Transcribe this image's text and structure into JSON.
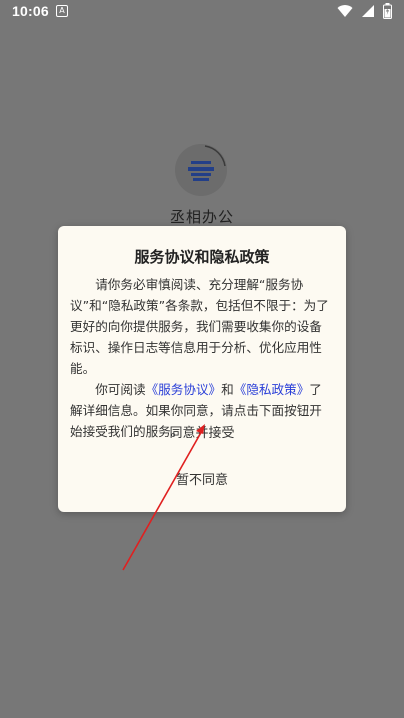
{
  "status_bar": {
    "time": "10:06",
    "notification_icon": "a-notification-icon",
    "icons": [
      "wifi-icon",
      "signal-icon",
      "battery-icon"
    ]
  },
  "splash": {
    "app_name": "丞相办公"
  },
  "dialog": {
    "title": "服务协议和隐私政策",
    "paragraph1": "请你务必审慎阅读、充分理解“服务协议”和“隐私政策”各条款，包括但不限于：为了更好的向你提供服务，我们需要收集你的设备标识、操作日志等信息用于分析、优化应用性能。",
    "p2_prefix": "你可阅读",
    "service_link": "《服务协议》",
    "p2_and": "和",
    "privacy_link": "《隐私政策》",
    "p2_suffix": "了解详细信息。如果你同意，请点击下面按钮开始接受我们的服务。",
    "accept_label": "同意并接受",
    "decline_label": "暂不同意"
  },
  "colors": {
    "overlay": "#777777",
    "dialog_bg": "#fdfaf2",
    "link": "#2a3fd8",
    "annotation": "#e02020"
  }
}
